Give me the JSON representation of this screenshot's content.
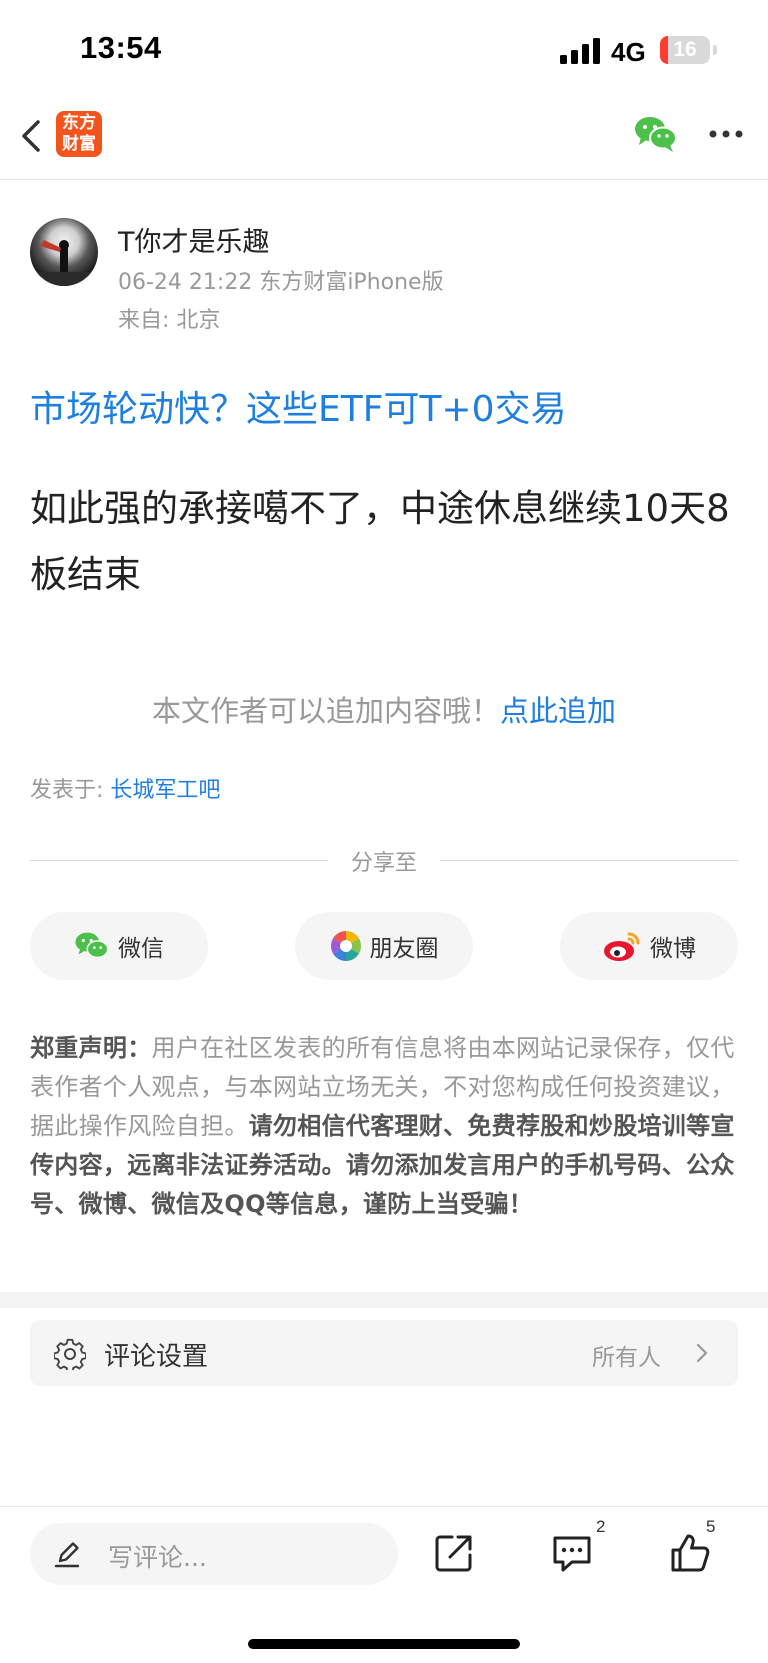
{
  "status_bar": {
    "time": "13:54",
    "network": "4G",
    "battery": "16",
    "battery_level": 0.16
  },
  "nav": {
    "logo_line1": "东方",
    "logo_line2": "财富"
  },
  "author": {
    "name": "T你才是乐趣",
    "meta": "06-24 21:22 东方财富iPhone版",
    "from": "来自: 北京"
  },
  "article": {
    "title": "市场轮动快？这些ETF可T+0交易",
    "body": "如此强的承接噶不了，中途休息继续10天8板结束"
  },
  "append": {
    "prompt": "本文作者可以追加内容哦！",
    "link": "点此追加"
  },
  "posted_in": {
    "label": "发表于: ",
    "bar": "长城军工吧"
  },
  "share": {
    "title": "分享至",
    "wechat": "微信",
    "moments": "朋友圈",
    "weibo": "微博"
  },
  "disclaimer": {
    "heading": "郑重声明：",
    "text": "用户在社区发表的所有信息将由本网站记录保存，仅代表作者个人观点，与本网站立场无关，不对您构成任何投资建议，据此操作风险自担。",
    "warning": "请勿相信代客理财、免费荐股和炒股培训等宣传内容，远离非法证券活动。请勿添加发言用户的手机号码、公众号、微博、微信及QQ等信息，谨防上当受骗！"
  },
  "comment_settings": {
    "label": "评论设置",
    "value": "所有人"
  },
  "bottom_bar": {
    "placeholder": "写评论...",
    "comment_count": "2",
    "like_count": "5"
  },
  "colors": {
    "accent": "#1e7fe0",
    "brand": "#f3541c",
    "battery_low": "#ff3b30"
  }
}
